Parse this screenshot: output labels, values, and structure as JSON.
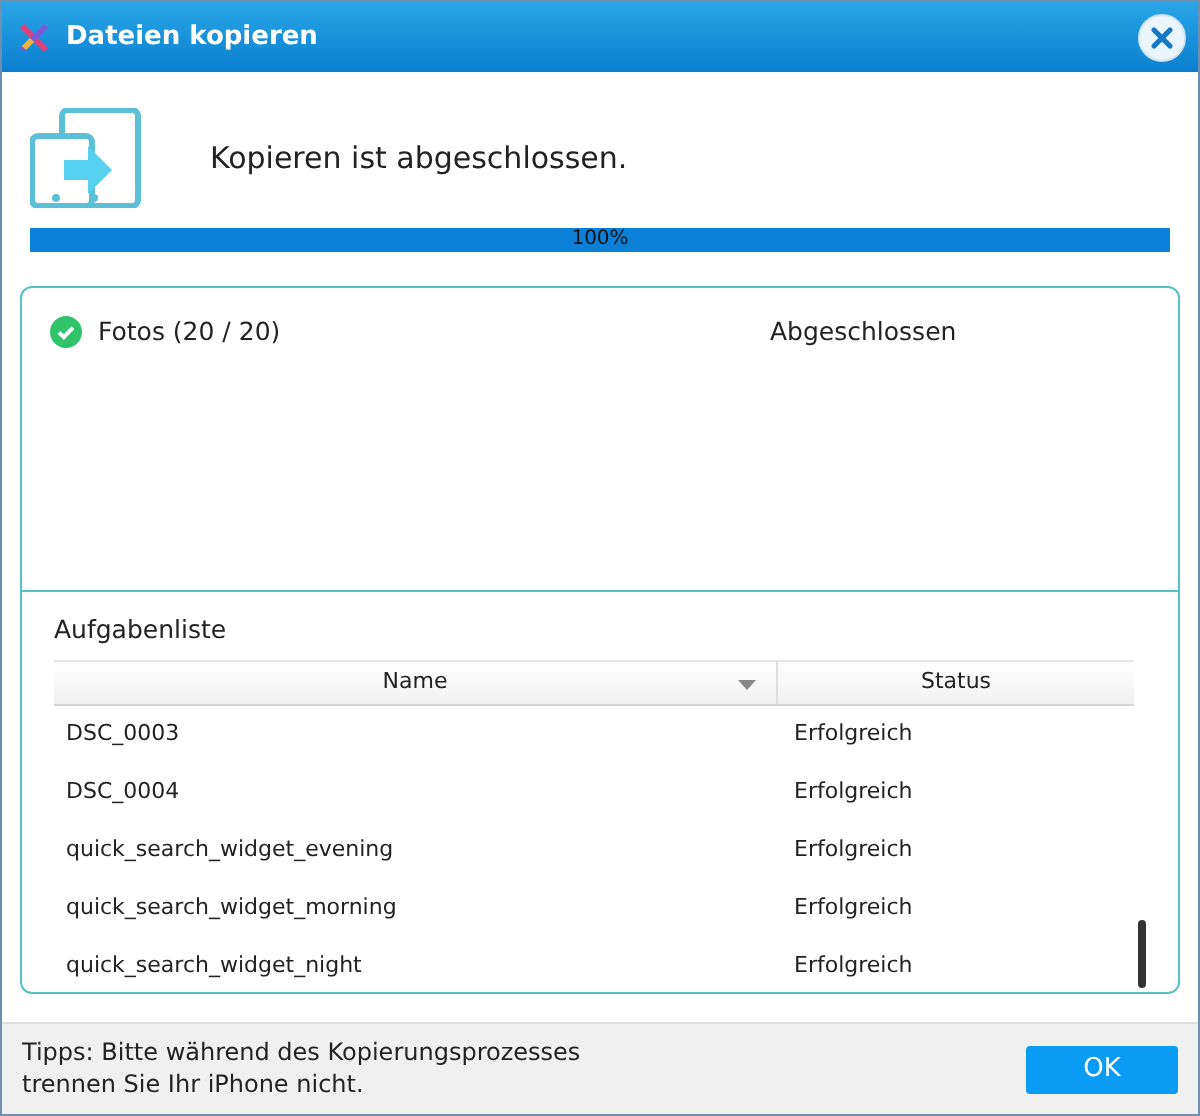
{
  "window": {
    "title": "Dateien kopieren"
  },
  "header": {
    "message": "Kopieren ist abgeschlossen."
  },
  "progress": {
    "level": 1.0,
    "reading": "100%"
  },
  "categories": [
    {
      "name": "Fotos (20 / 20)",
      "status": "Abgeschlossen",
      "done": true
    }
  ],
  "task_list": {
    "title": "Aufgabenliste",
    "columns": [
      "Name",
      "Status"
    ],
    "rows": [
      {
        "name": "DSC_0003",
        "status": "Erfolgreich"
      },
      {
        "name": "DSC_0004",
        "status": "Erfolgreich"
      },
      {
        "name": "quick_search_widget_evening",
        "status": "Erfolgreich"
      },
      {
        "name": "quick_search_widget_morning",
        "status": "Erfolgreich"
      },
      {
        "name": "quick_search_widget_night",
        "status": "Erfolgreich"
      }
    ]
  },
  "footer": {
    "tip": "Tipps: Bitte während des Kopierungsprozesses trennen Sie Ihr iPhone nicht.",
    "button": "OK"
  }
}
